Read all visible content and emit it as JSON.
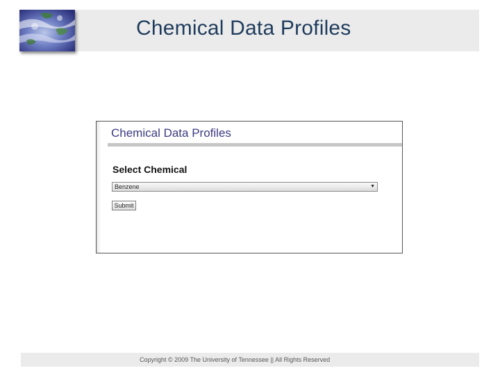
{
  "slide": {
    "title": "Chemical Data Profiles"
  },
  "form": {
    "heading": "Chemical Data Profiles",
    "select_label": "Select Chemical",
    "select_value": "Benzene",
    "submit_label": "Submit"
  },
  "footer": {
    "copyright": "Copyright © 2009 The University of Tennessee || All Rights Reserved"
  },
  "colors": {
    "title": "#1f3b5c",
    "heading": "#3a3a80",
    "band": "#ebebeb"
  },
  "icons": {
    "logo": "earth-satellite-image",
    "select_arrow": "dropdown-arrow-icon"
  }
}
